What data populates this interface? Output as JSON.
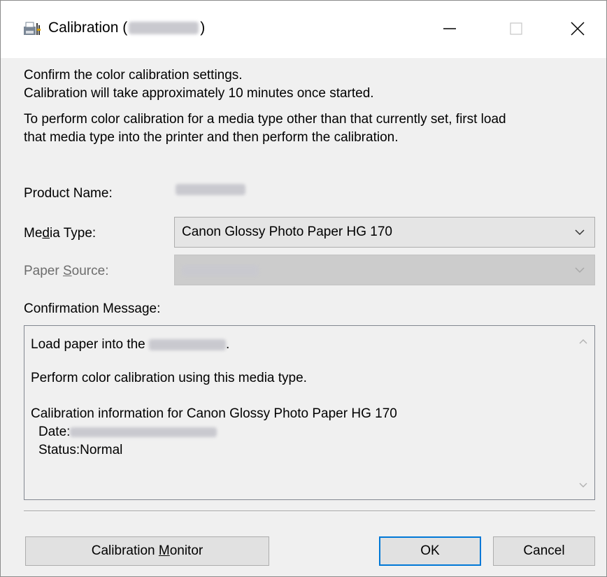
{
  "window": {
    "title_prefix": "Calibration (",
    "title_suffix": ")",
    "minimize_glyph": "—",
    "close_glyph": "✕"
  },
  "intro": {
    "line1": "Confirm the color calibration settings.",
    "line2": "Calibration will take approximately 10 minutes once started.",
    "line3": "To perform color calibration for a media type other than that currently set, first load",
    "line4": "that media type into the printer and then perform the calibration."
  },
  "product": {
    "label": "Product Name:"
  },
  "media_type": {
    "label_pre": "Me",
    "label_ul": "d",
    "label_post": "ia Type:",
    "value": "Canon Glossy Photo Paper HG 170"
  },
  "paper_source": {
    "label_pre": "Paper ",
    "label_ul": "S",
    "label_post": "ource:"
  },
  "confirmation": {
    "label": "Confirmation Message:",
    "line1_pre": "Load paper into the",
    "line1_post": ".",
    "line2": "Perform color calibration using this media type.",
    "line3": "Calibration information for Canon Glossy Photo Paper HG 170",
    "date_label": "Date:",
    "status_line": "Status:Normal"
  },
  "buttons": {
    "monitor_pre": "Calibration ",
    "monitor_ul": "M",
    "monitor_post": "onitor",
    "ok": "OK",
    "cancel": "Cancel"
  },
  "colors": {
    "accent": "#0078d7",
    "dialog_bg": "#f0f0f0",
    "disabled_text": "#6d6d6d"
  },
  "icons": {
    "app": "printer-calibration-icon",
    "minimize": "minimize-icon",
    "maximize": "maximize-icon",
    "close": "close-icon",
    "dropdown": "chevron-down-icon",
    "scroll_up": "scroll-up-icon",
    "scroll_down": "scroll-down-icon"
  }
}
